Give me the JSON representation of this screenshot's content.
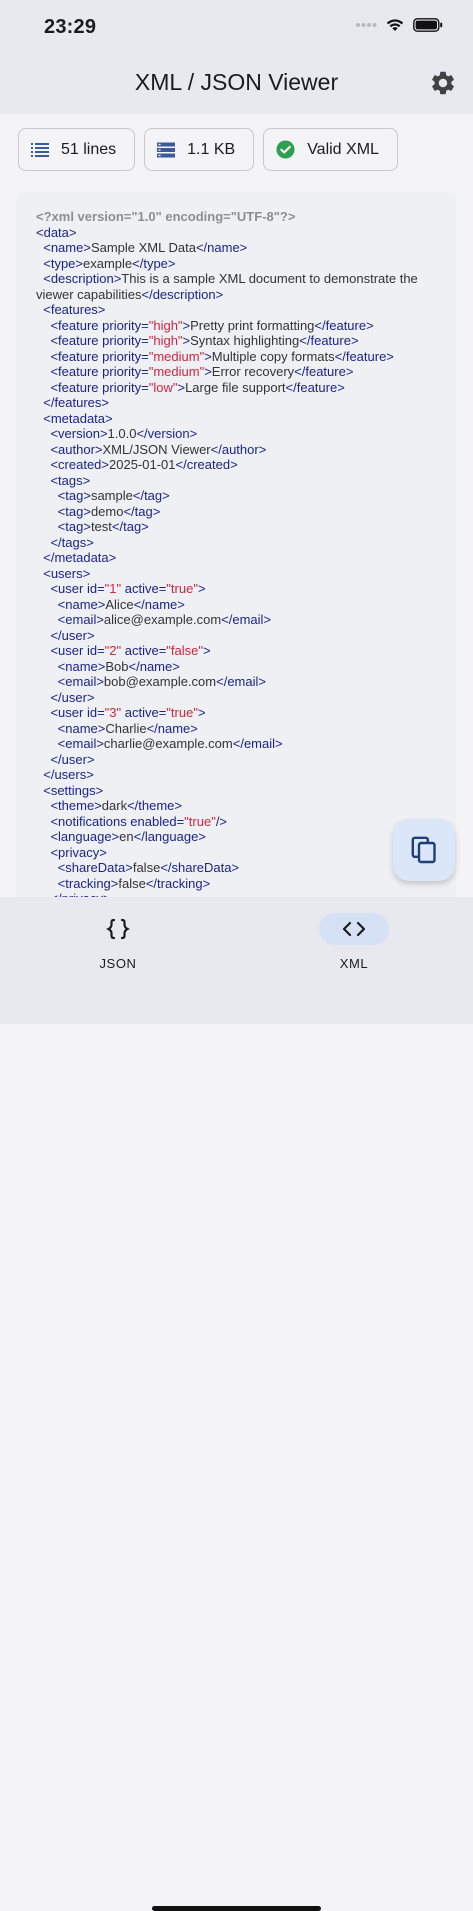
{
  "status_bar": {
    "time": "23:29"
  },
  "app_bar": {
    "title": "XML / JSON Viewer",
    "settings_icon": "gear-icon"
  },
  "chips": [
    {
      "icon": "list-icon",
      "label": "51 lines"
    },
    {
      "icon": "storage-icon",
      "label": "1.1 KB"
    },
    {
      "icon": "check-circle-icon",
      "label": "Valid XML"
    }
  ],
  "colors": {
    "tag": "#1a2586",
    "value": "#d0253f",
    "text": "#333333",
    "declaration": "#8e8e92",
    "valid": "#2e9e4f"
  },
  "code_lines": [
    [
      {
        "t": "decl",
        "v": "<?xml version=\"1.0\" encoding=\"UTF-8\"?>"
      }
    ],
    [
      {
        "t": "tag",
        "v": "<data>"
      }
    ],
    [
      {
        "t": "txt",
        "v": "  "
      },
      {
        "t": "tag",
        "v": "<name>"
      },
      {
        "t": "txt",
        "v": "Sample XML Data"
      },
      {
        "t": "tag",
        "v": "</name>"
      }
    ],
    [
      {
        "t": "txt",
        "v": "  "
      },
      {
        "t": "tag",
        "v": "<type>"
      },
      {
        "t": "txt",
        "v": "example"
      },
      {
        "t": "tag",
        "v": "</type>"
      }
    ],
    [
      {
        "t": "txt",
        "v": "  "
      },
      {
        "t": "tag",
        "v": "<description>"
      },
      {
        "t": "txt",
        "v": "This is a sample XML document to demonstrate the viewer capabilities"
      },
      {
        "t": "tag",
        "v": "</description>"
      }
    ],
    [
      {
        "t": "txt",
        "v": "  "
      },
      {
        "t": "tag",
        "v": "<features>"
      }
    ],
    [
      {
        "t": "txt",
        "v": "    "
      },
      {
        "t": "tag",
        "v": "<feature priority="
      },
      {
        "t": "val",
        "v": "\"high\""
      },
      {
        "t": "tag",
        "v": ">"
      },
      {
        "t": "txt",
        "v": "Pretty print formatting"
      },
      {
        "t": "tag",
        "v": "</feature>"
      }
    ],
    [
      {
        "t": "txt",
        "v": "    "
      },
      {
        "t": "tag",
        "v": "<feature priority="
      },
      {
        "t": "val",
        "v": "\"high\""
      },
      {
        "t": "tag",
        "v": ">"
      },
      {
        "t": "txt",
        "v": "Syntax highlighting"
      },
      {
        "t": "tag",
        "v": "</feature>"
      }
    ],
    [
      {
        "t": "txt",
        "v": "    "
      },
      {
        "t": "tag",
        "v": "<feature priority="
      },
      {
        "t": "val",
        "v": "\"medium\""
      },
      {
        "t": "tag",
        "v": ">"
      },
      {
        "t": "txt",
        "v": "Multiple copy formats"
      },
      {
        "t": "tag",
        "v": "</feature>"
      }
    ],
    [
      {
        "t": "txt",
        "v": "    "
      },
      {
        "t": "tag",
        "v": "<feature priority="
      },
      {
        "t": "val",
        "v": "\"medium\""
      },
      {
        "t": "tag",
        "v": ">"
      },
      {
        "t": "txt",
        "v": "Error recovery"
      },
      {
        "t": "tag",
        "v": "</feature>"
      }
    ],
    [
      {
        "t": "txt",
        "v": "    "
      },
      {
        "t": "tag",
        "v": "<feature priority="
      },
      {
        "t": "val",
        "v": "\"low\""
      },
      {
        "t": "tag",
        "v": ">"
      },
      {
        "t": "txt",
        "v": "Large file support"
      },
      {
        "t": "tag",
        "v": "</feature>"
      }
    ],
    [
      {
        "t": "txt",
        "v": "  "
      },
      {
        "t": "tag",
        "v": "</features>"
      }
    ],
    [
      {
        "t": "txt",
        "v": "  "
      },
      {
        "t": "tag",
        "v": "<metadata>"
      }
    ],
    [
      {
        "t": "txt",
        "v": "    "
      },
      {
        "t": "tag",
        "v": "<version>"
      },
      {
        "t": "txt",
        "v": "1.0.0"
      },
      {
        "t": "tag",
        "v": "</version>"
      }
    ],
    [
      {
        "t": "txt",
        "v": "    "
      },
      {
        "t": "tag",
        "v": "<author>"
      },
      {
        "t": "txt",
        "v": "XML/JSON Viewer"
      },
      {
        "t": "tag",
        "v": "</author>"
      }
    ],
    [
      {
        "t": "txt",
        "v": "    "
      },
      {
        "t": "tag",
        "v": "<created>"
      },
      {
        "t": "txt",
        "v": "2025-01-01"
      },
      {
        "t": "tag",
        "v": "</created>"
      }
    ],
    [
      {
        "t": "txt",
        "v": "    "
      },
      {
        "t": "tag",
        "v": "<tags>"
      }
    ],
    [
      {
        "t": "txt",
        "v": "      "
      },
      {
        "t": "tag",
        "v": "<tag>"
      },
      {
        "t": "txt",
        "v": "sample"
      },
      {
        "t": "tag",
        "v": "</tag>"
      }
    ],
    [
      {
        "t": "txt",
        "v": "      "
      },
      {
        "t": "tag",
        "v": "<tag>"
      },
      {
        "t": "txt",
        "v": "demo"
      },
      {
        "t": "tag",
        "v": "</tag>"
      }
    ],
    [
      {
        "t": "txt",
        "v": "      "
      },
      {
        "t": "tag",
        "v": "<tag>"
      },
      {
        "t": "txt",
        "v": "test"
      },
      {
        "t": "tag",
        "v": "</tag>"
      }
    ],
    [
      {
        "t": "txt",
        "v": "    "
      },
      {
        "t": "tag",
        "v": "</tags>"
      }
    ],
    [
      {
        "t": "txt",
        "v": "  "
      },
      {
        "t": "tag",
        "v": "</metadata>"
      }
    ],
    [
      {
        "t": "txt",
        "v": "  "
      },
      {
        "t": "tag",
        "v": "<users>"
      }
    ],
    [
      {
        "t": "txt",
        "v": "    "
      },
      {
        "t": "tag",
        "v": "<user id="
      },
      {
        "t": "val",
        "v": "\"1\""
      },
      {
        "t": "tag",
        "v": " active="
      },
      {
        "t": "val",
        "v": "\"true\""
      },
      {
        "t": "tag",
        "v": ">"
      }
    ],
    [
      {
        "t": "txt",
        "v": "      "
      },
      {
        "t": "tag",
        "v": "<name>"
      },
      {
        "t": "txt",
        "v": "Alice"
      },
      {
        "t": "tag",
        "v": "</name>"
      }
    ],
    [
      {
        "t": "txt",
        "v": "      "
      },
      {
        "t": "tag",
        "v": "<email>"
      },
      {
        "t": "txt",
        "v": "alice@example.com"
      },
      {
        "t": "tag",
        "v": "</email>"
      }
    ],
    [
      {
        "t": "txt",
        "v": "    "
      },
      {
        "t": "tag",
        "v": "</user>"
      }
    ],
    [
      {
        "t": "txt",
        "v": "    "
      },
      {
        "t": "tag",
        "v": "<user id="
      },
      {
        "t": "val",
        "v": "\"2\""
      },
      {
        "t": "tag",
        "v": " active="
      },
      {
        "t": "val",
        "v": "\"false\""
      },
      {
        "t": "tag",
        "v": ">"
      }
    ],
    [
      {
        "t": "txt",
        "v": "      "
      },
      {
        "t": "tag",
        "v": "<name>"
      },
      {
        "t": "txt",
        "v": "Bob"
      },
      {
        "t": "tag",
        "v": "</name>"
      }
    ],
    [
      {
        "t": "txt",
        "v": "      "
      },
      {
        "t": "tag",
        "v": "<email>"
      },
      {
        "t": "txt",
        "v": "bob@example.com"
      },
      {
        "t": "tag",
        "v": "</email>"
      }
    ],
    [
      {
        "t": "txt",
        "v": "    "
      },
      {
        "t": "tag",
        "v": "</user>"
      }
    ],
    [
      {
        "t": "txt",
        "v": "    "
      },
      {
        "t": "tag",
        "v": "<user id="
      },
      {
        "t": "val",
        "v": "\"3\""
      },
      {
        "t": "tag",
        "v": " active="
      },
      {
        "t": "val",
        "v": "\"true\""
      },
      {
        "t": "tag",
        "v": ">"
      }
    ],
    [
      {
        "t": "txt",
        "v": "      "
      },
      {
        "t": "tag",
        "v": "<name>"
      },
      {
        "t": "txt",
        "v": "Charlie"
      },
      {
        "t": "tag",
        "v": "</name>"
      }
    ],
    [
      {
        "t": "txt",
        "v": "      "
      },
      {
        "t": "tag",
        "v": "<email>"
      },
      {
        "t": "txt",
        "v": "charlie@example.com"
      },
      {
        "t": "tag",
        "v": "</email>"
      }
    ],
    [
      {
        "t": "txt",
        "v": "    "
      },
      {
        "t": "tag",
        "v": "</user>"
      }
    ],
    [
      {
        "t": "txt",
        "v": "  "
      },
      {
        "t": "tag",
        "v": "</users>"
      }
    ],
    [
      {
        "t": "txt",
        "v": "  "
      },
      {
        "t": "tag",
        "v": "<settings>"
      }
    ],
    [
      {
        "t": "txt",
        "v": "    "
      },
      {
        "t": "tag",
        "v": "<theme>"
      },
      {
        "t": "txt",
        "v": "dark"
      },
      {
        "t": "tag",
        "v": "</theme>"
      }
    ],
    [
      {
        "t": "txt",
        "v": "    "
      },
      {
        "t": "tag",
        "v": "<notifications enabled="
      },
      {
        "t": "val",
        "v": "\"true\""
      },
      {
        "t": "tag",
        "v": "/>"
      }
    ],
    [
      {
        "t": "txt",
        "v": "    "
      },
      {
        "t": "tag",
        "v": "<language>"
      },
      {
        "t": "txt",
        "v": "en"
      },
      {
        "t": "tag",
        "v": "</language>"
      }
    ],
    [
      {
        "t": "txt",
        "v": "    "
      },
      {
        "t": "tag",
        "v": "<privacy>"
      }
    ],
    [
      {
        "t": "txt",
        "v": "      "
      },
      {
        "t": "tag",
        "v": "<shareData>"
      },
      {
        "t": "txt",
        "v": "false"
      },
      {
        "t": "tag",
        "v": "</shareData>"
      }
    ],
    [
      {
        "t": "txt",
        "v": "      "
      },
      {
        "t": "tag",
        "v": "<tracking>"
      },
      {
        "t": "txt",
        "v": "false"
      },
      {
        "t": "tag",
        "v": "</tracking>"
      }
    ],
    [
      {
        "t": "txt",
        "v": "    "
      },
      {
        "t": "tag",
        "v": "</privacy>"
      }
    ]
  ],
  "fab": {
    "icon": "copy-icon"
  },
  "bottom_nav": [
    {
      "icon": "braces-icon",
      "label": "JSON",
      "active": false
    },
    {
      "icon": "code-icon",
      "label": "XML",
      "active": true
    }
  ]
}
